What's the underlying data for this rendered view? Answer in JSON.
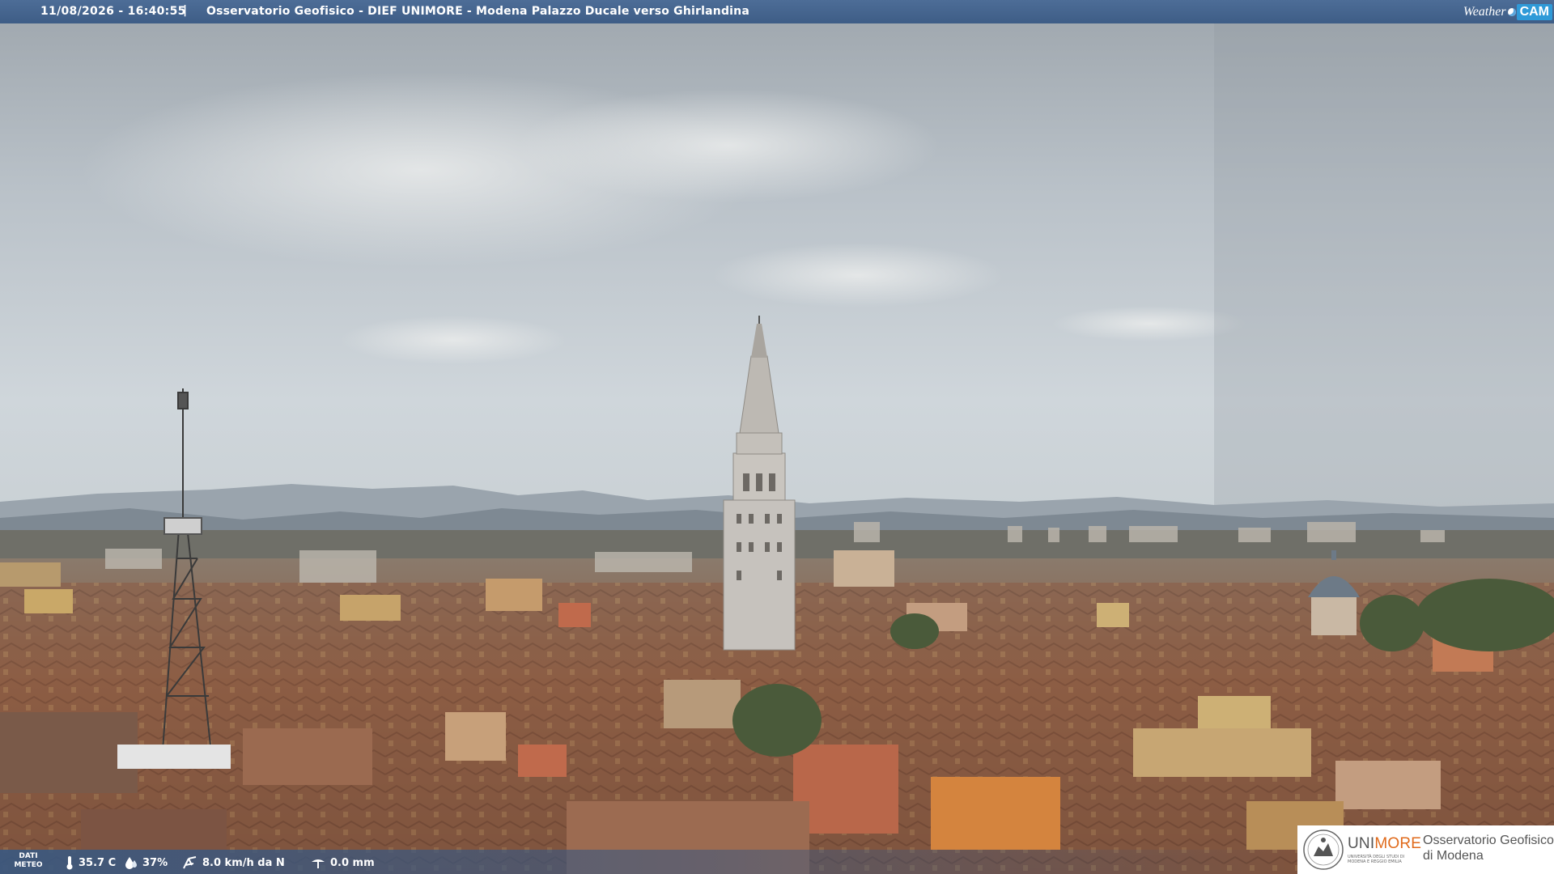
{
  "header": {
    "timestamp": "11/08/2026 - 16:40:55",
    "separator": "|",
    "camera_title": "Osservatorio Geofisico - DIEF UNIMORE - Modena Palazzo Ducale verso Ghirlandina",
    "logo": {
      "weather": "Weather",
      "cam": "CAM"
    }
  },
  "weather": {
    "label_line1": "DATI",
    "label_line2": "METEO",
    "temperature": "35.7 C",
    "humidity": "37%",
    "wind": "8.0 km/h da N",
    "rain": "0.0 mm",
    "icons": [
      "thermometer-icon",
      "humidity-drop-icon",
      "wind-icon",
      "rain-gauge-icon"
    ]
  },
  "sponsor": {
    "brand_uni": "UNI",
    "brand_more": "MORE",
    "brand_subtitle": "UNIVERSITÀ DEGLI STUDI DI MODENA E REGGIO EMILIA",
    "observatory_line1": "Osservatorio Geofisico",
    "observatory_line2": "di Modena"
  },
  "colors": {
    "bar": "#3e5d86",
    "accent_orange": "#e06a1b",
    "cam_blue": "#2f9ad8"
  }
}
